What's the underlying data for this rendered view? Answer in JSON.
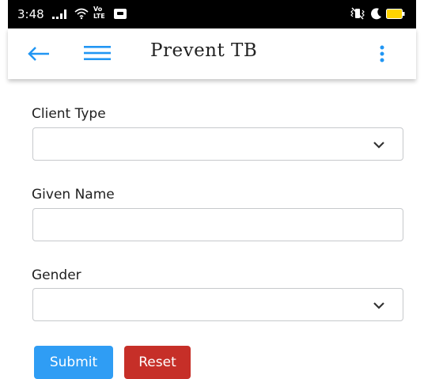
{
  "status_bar": {
    "time": "3:48",
    "network_label": "Vo\nLTE",
    "icons": [
      "signal-icon",
      "wifi-icon",
      "volte-icon",
      "message-icon",
      "vibrate-icon",
      "do-not-disturb-icon",
      "battery-icon"
    ]
  },
  "app_bar": {
    "title": "Prevent TB",
    "icons": [
      "back-arrow-icon",
      "menu-icon",
      "more-vert-icon"
    ],
    "accent_color": "#2196f3"
  },
  "form": {
    "client_type": {
      "label": "Client Type",
      "value": ""
    },
    "given_name": {
      "label": "Given Name",
      "value": "",
      "placeholder": ""
    },
    "gender": {
      "label": "Gender",
      "value": ""
    }
  },
  "buttons": {
    "submit": {
      "label": "Submit",
      "color": "#2f9df4"
    },
    "reset": {
      "label": "Reset",
      "color": "#c62f28"
    }
  }
}
